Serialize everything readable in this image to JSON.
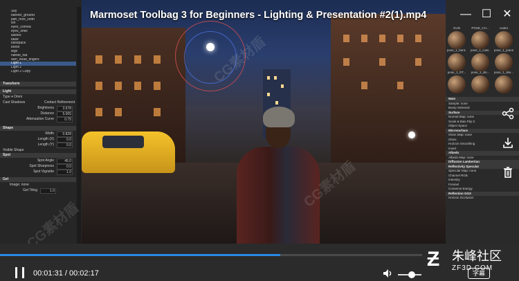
{
  "player": {
    "title": "Marmoset Toolbag 3 for Beginners - Lighting & Presentation #2(1).mp4",
    "current_time": "00:01:31",
    "separator": " / ",
    "duration": "00:02:17",
    "progress": 0.664,
    "volume": 0.6,
    "subtitle_label": "字幕",
    "brand_name": "朱峰社区",
    "brand_domain": "ZF3D.COM",
    "watermark": "CG素材盾",
    "accent": "#2a8ae8",
    "icons": {
      "minimize": "minimize-icon",
      "maximize": "maximize-icon",
      "close": "close-icon",
      "share": "share-icon",
      "download": "download-icon",
      "delete": "trash-icon",
      "pause": "pause-icon",
      "volume": "volume-icon",
      "fullscreen": "fullscreen-icon"
    }
  },
  "scene_tree": [
    "Sky",
    "banner_ground",
    "pan_rock_cloth",
    "lsh",
    "eyes_cornea",
    "eyes_shell",
    "lashes",
    "base",
    "backpack",
    "boots",
    "legs",
    "hands_hat",
    "skin_head_fingers",
    "Light 1",
    "Light 2",
    "Light 2 Copy"
  ],
  "selected_tree_item": "Light 1",
  "left_panel": {
    "transform_header": "Transform",
    "light_header": "Light",
    "type_label": "Type",
    "type_value": "Omni",
    "cast_shadows": "Cast Shadows",
    "contact_refinement": "Contact Refinement",
    "props": [
      {
        "label": "Brightness",
        "value": "3.578"
      },
      {
        "label": "Distance",
        "value": "5.005"
      },
      {
        "label": "Attenuation Curve",
        "value": "0.75"
      }
    ],
    "shape_header": "Shape",
    "shape_props": [
      {
        "label": "Width",
        "value": "0.828"
      },
      {
        "label": "Length (X)",
        "value": "0.0"
      },
      {
        "label": "Length (Y)",
        "value": "0.0"
      }
    ],
    "visible_shape": "Visible Shape",
    "spot_header": "Spot",
    "spot_props": [
      {
        "label": "Spot Angle",
        "value": "45.0"
      },
      {
        "label": "Spot Sharpness",
        "value": "0.0"
      },
      {
        "label": "Spot Vignette",
        "value": "1.0"
      }
    ],
    "gel_header": "Gel",
    "gel_image": "Image",
    "gel_image_value": "none",
    "gel_tiling_label": "Gel Tiling",
    "gel_tiling_value": "1.0"
  },
  "right_panel": {
    "materials": [
      "GUN",
      "POSE_CH...",
      "cuatro",
      "pose_1_bant...",
      "pose_1_coat...",
      "pose_1_jeans...",
      "pose_1_RT...",
      "pose_1_ski...",
      "pose_1_ske..."
    ],
    "sections": [
      {
        "text": "Main",
        "header": true
      },
      {
        "text": "Sample: none",
        "header": false
      },
      {
        "text": "Bump Selected",
        "header": false
      },
      {
        "text": "Surface",
        "header": true
      },
      {
        "text": "Normal Map: none",
        "header": false
      },
      {
        "text": "Scale & Bias  Flip X",
        "header": false
      },
      {
        "text": "Object Space",
        "header": false
      },
      {
        "text": "Microsurface",
        "header": true
      },
      {
        "text": "Gloss Map: none",
        "header": false
      },
      {
        "text": "Gloss",
        "header": false
      },
      {
        "text": "Horizon Smoothing",
        "header": false
      },
      {
        "text": "Invert",
        "header": false
      },
      {
        "text": "Albedo",
        "header": true
      },
      {
        "text": "Albedo Map: none",
        "header": false
      },
      {
        "text": "Diffusion  Lambertian",
        "header": true
      },
      {
        "text": "Reflectivity  Specular",
        "header": true
      },
      {
        "text": "Specular Map: none",
        "header": false
      },
      {
        "text": "Channel  RGB",
        "header": false
      },
      {
        "text": "Intensity",
        "header": false
      },
      {
        "text": "Fresnel",
        "header": false
      },
      {
        "text": "Conserve Energy",
        "header": false
      },
      {
        "text": "Reflection  GGX",
        "header": true
      },
      {
        "text": "Horizon Occlusion",
        "header": false
      }
    ]
  }
}
